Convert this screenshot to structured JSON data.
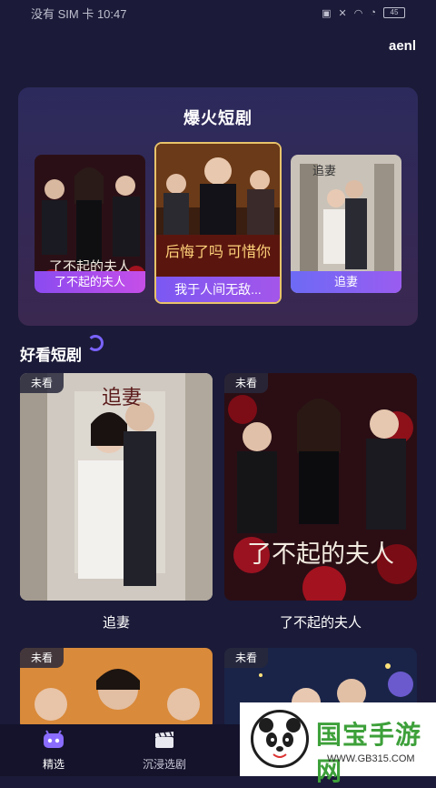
{
  "status_bar": {
    "left": "没有 SIM 卡 10:47",
    "battery": "45"
  },
  "app": {
    "title": "aenl"
  },
  "hot": {
    "title": "爆火短剧",
    "cards": [
      {
        "label": "了不起的夫人",
        "poster_text": "了不起的夫人"
      },
      {
        "label": "我于人间无敌...",
        "poster_text": "后悔了吗 可惜你"
      },
      {
        "label": "追妻",
        "poster_text": "追妻"
      }
    ]
  },
  "good": {
    "title": "好看短剧",
    "cards": [
      {
        "tag": "未看",
        "name": "追妻",
        "poster_text": "追妻"
      },
      {
        "tag": "未看",
        "name": "了不起的夫人",
        "poster_text": "了不起的夫人"
      },
      {
        "tag": "未看",
        "name": ""
      },
      {
        "tag": "未看",
        "name": ""
      }
    ]
  },
  "tabbar": {
    "tabs": [
      {
        "label": "精选"
      },
      {
        "label": "沉浸选剧"
      }
    ]
  },
  "watermark": {
    "title": "国宝手游网",
    "url": "WWW.GB315.COM"
  },
  "colors": {
    "background": "#1b1a38",
    "accent": "#8a4bf0",
    "gold": "#e8c36a"
  }
}
